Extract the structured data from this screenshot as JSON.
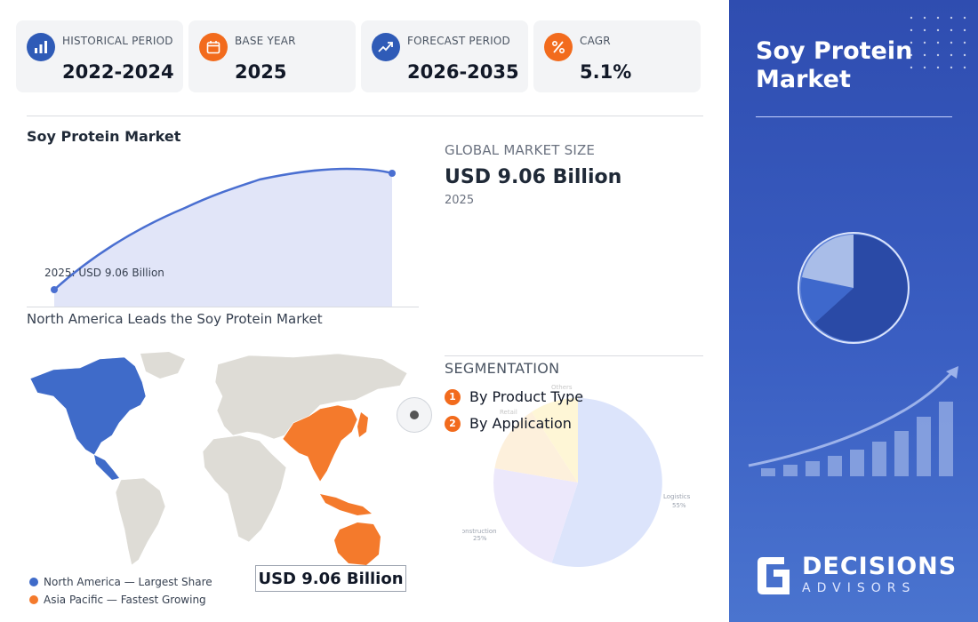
{
  "kpis": [
    {
      "label": "HISTORICAL PERIOD",
      "value": "2022-2024",
      "icon": "bar-chart-icon",
      "color": "#2f5bb7"
    },
    {
      "label": "BASE YEAR",
      "value": "2025",
      "icon": "calendar-icon",
      "color": "#f26b1d"
    },
    {
      "label": "FORECAST PERIOD",
      "value": "2026-2035",
      "icon": "trend-up-icon",
      "color": "#2f5bb7"
    },
    {
      "label": "CAGR",
      "value": "5.1%",
      "icon": "percent-icon",
      "color": "#f26b1d"
    }
  ],
  "market_chart": {
    "title": "Soy Protein Market",
    "annotation": "2025: USD 9.06 Billion"
  },
  "market_size": {
    "label": "GLOBAL MARKET SIZE",
    "value": "USD 9.06 Billion",
    "year": "2025"
  },
  "map": {
    "title": "North America Leads the Soy Protein Market",
    "value_box": "USD 9.06 Billion",
    "legend": [
      {
        "label": "North America — Largest Share",
        "color": "#3f6bc9"
      },
      {
        "label": "Asia Pacific — Fastest Growing",
        "color": "#f47a2c"
      }
    ]
  },
  "segmentation": {
    "title": "SEGMENTATION",
    "items": [
      {
        "num": "1",
        "label": "By Product Type"
      },
      {
        "num": "2",
        "label": "By Application"
      }
    ],
    "pie_labels": [
      {
        "label": "Logistics",
        "value": "55%"
      },
      {
        "label": "Construction",
        "value": "25%"
      },
      {
        "label": "Retail",
        "value": ""
      },
      {
        "label": "Others",
        "value": ""
      }
    ]
  },
  "panel": {
    "title": "Soy Protein Market",
    "brand_name": "DECISIONS",
    "brand_sub": "ADVISORS"
  },
  "colors": {
    "accent_blue": "#2f5bb7",
    "accent_orange": "#f26b1d",
    "panel_blue": "#3a5ec2"
  }
}
